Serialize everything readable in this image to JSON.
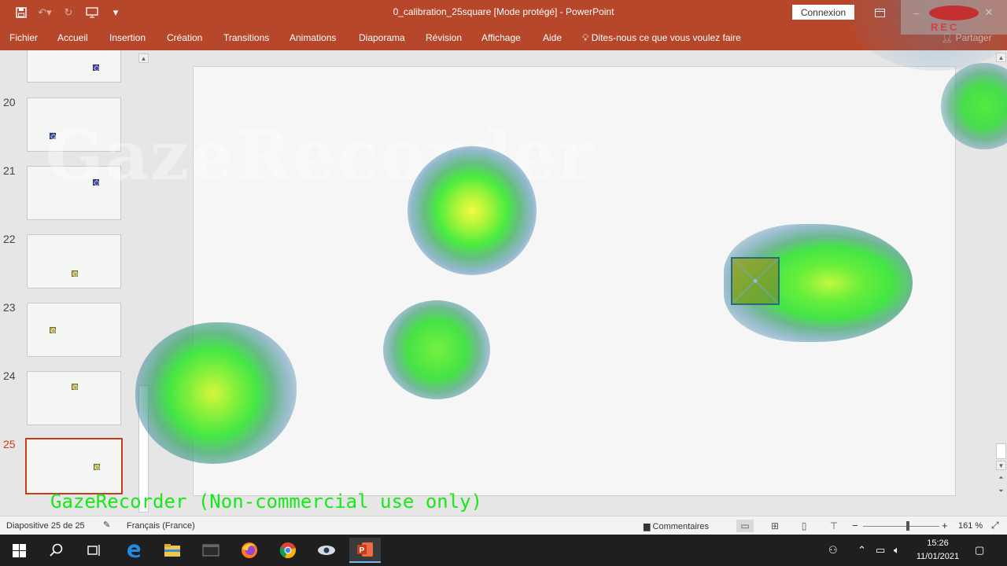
{
  "window": {
    "title": "0_calibration_25square [Mode protégé]  -  PowerPoint",
    "connexion_label": "Connexion",
    "share_label": "Partager"
  },
  "ribbon": {
    "tabs": [
      "Fichier",
      "Accueil",
      "Insertion",
      "Création",
      "Transitions",
      "Animations",
      "Diaporama",
      "Révision",
      "Affichage",
      "Aide"
    ],
    "tell_me": "Dites-nous ce que vous voulez faire"
  },
  "slides_pane": {
    "numbers": [
      "20",
      "21",
      "22",
      "23",
      "24",
      "25"
    ],
    "selected": "25"
  },
  "overlay": {
    "watermark": "GazeRecorder",
    "footer": "GazeRecorder (Non-commercial use only)",
    "rec_label": "REC"
  },
  "statusbar": {
    "slide_info": "Diapositive 25 de 25",
    "language": "Français (France)",
    "comments": "Commentaires",
    "zoom": "161 %"
  },
  "taskbar": {
    "time": "15:26",
    "date": "11/01/2021"
  },
  "colors": {
    "accent": "#b7472a",
    "heat_core": "#f2f63a",
    "heat_mid": "#2ee82e",
    "heat_edge": "#2a6fa0",
    "footer_text": "#18e818"
  }
}
